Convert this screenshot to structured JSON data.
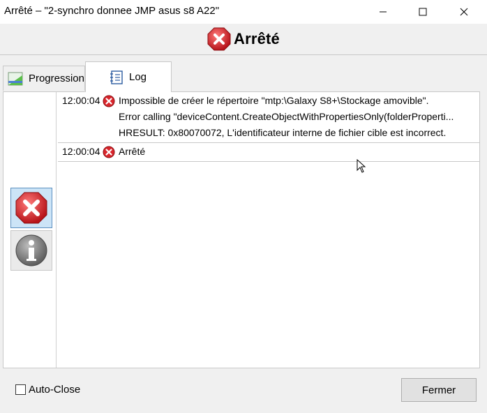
{
  "window": {
    "title": "Arrêté – \"2-synchro donnee JMP asus s8 A22\"",
    "controls": [
      "minimize-icon",
      "maximize-icon",
      "close-icon"
    ]
  },
  "status": {
    "label": "Arrêté",
    "icon": "error-icon",
    "icon_color": "#d9252b"
  },
  "tabs": [
    {
      "label": "Progression",
      "icon": "progress-icon",
      "selected": false
    },
    {
      "label": "Log",
      "icon": "log-icon",
      "selected": true
    }
  ],
  "filters": [
    {
      "name": "errors",
      "icon": "error-icon",
      "active": true
    },
    {
      "name": "info",
      "icon": "info-icon",
      "active": false
    }
  ],
  "log": {
    "entries": [
      {
        "time": "12:00:04",
        "icon": "error-icon",
        "lines": [
          "Impossible de créer le répertoire \"mtp:\\Galaxy S8+\\Stockage amovible\".",
          "Error calling \"deviceContent.CreateObjectWithPropertiesOnly(folderProperti...",
          "HRESULT: 0x80070072, L'identificateur interne de fichier cible est incorrect."
        ]
      },
      {
        "time": "12:00:04",
        "icon": "error-icon",
        "lines": [
          "Arrêté"
        ]
      }
    ]
  },
  "footer": {
    "autoclose_label": "Auto-Close",
    "autoclose_checked": false,
    "close_button_label": "Fermer"
  },
  "colors": {
    "accent": "#5b8fbf",
    "error_red": "#d9252b",
    "selected_filter_bg": "#cce4f7"
  }
}
